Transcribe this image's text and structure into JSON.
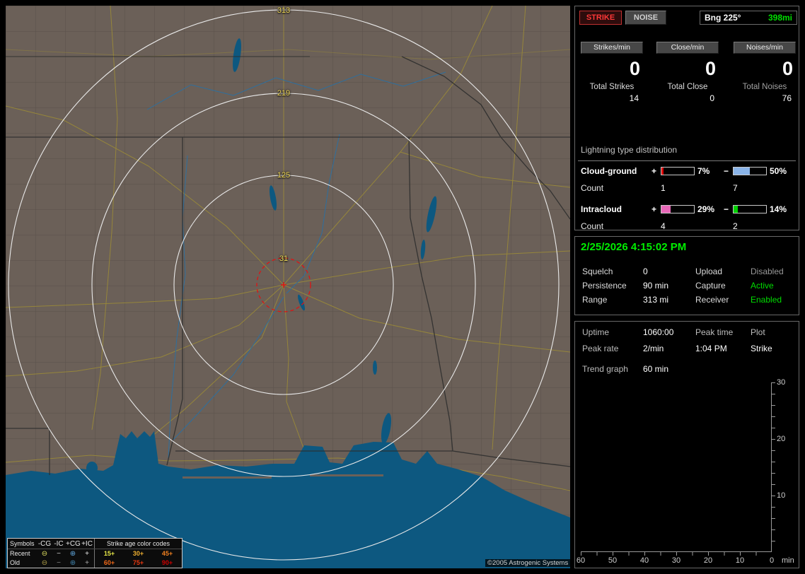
{
  "header": {
    "strike_button": "STRIKE",
    "noise_button": "NOISE",
    "bearing_label": "Bng 225°",
    "bearing_range": "398mi"
  },
  "rates": [
    {
      "label": "Strikes/min",
      "value": "0",
      "total_label": "Total Strikes",
      "total_value": "14"
    },
    {
      "label": "Close/min",
      "value": "0",
      "total_label": "Total Close",
      "total_value": "0"
    },
    {
      "label": "Noises/min",
      "value": "0",
      "total_label": "Total Noises",
      "total_value": "76"
    }
  ],
  "distribution": {
    "title": "Lightning type distribution",
    "rows": [
      {
        "label": "Cloud-ground",
        "plus_sign": "+",
        "plus_pct_num": 7,
        "plus_pct": "7%",
        "plus_color": "#e00000",
        "minus_sign": "−",
        "minus_pct_num": 50,
        "minus_pct": "50%",
        "minus_color": "#8ab4e8",
        "count_label": "Count",
        "plus_count": "1",
        "minus_count": "7"
      },
      {
        "label": "Intracloud",
        "plus_sign": "+",
        "plus_pct_num": 29,
        "plus_pct": "29%",
        "plus_color": "#e868b8",
        "minus_sign": "−",
        "minus_pct_num": 14,
        "minus_pct": "14%",
        "minus_color": "#00d000",
        "count_label": "Count",
        "plus_count": "4",
        "minus_count": "2"
      }
    ]
  },
  "status": {
    "datetime": "2/25/2026 4:15:02 PM",
    "rows": [
      {
        "label1": "Squelch",
        "value1": "0",
        "label2": "Upload",
        "value2": "Disabled",
        "value2_color": "#989898"
      },
      {
        "label1": "Persistence",
        "value1": "90 min",
        "label2": "Capture",
        "value2": "Active",
        "value2_color": "#00dd00"
      },
      {
        "label1": "Range",
        "value1": "313 mi",
        "label2": "Receiver",
        "value2": "Enabled",
        "value2_color": "#00dd00"
      }
    ]
  },
  "session": {
    "uptime_label": "Uptime",
    "uptime_value": "1060:00",
    "peak_time_label": "Peak time",
    "plot_label": "Plot",
    "peak_rate_label": "Peak rate",
    "peak_rate_value": "2/min",
    "peak_time_value": "1:04 PM",
    "plot_value": "Strike",
    "trend_label": "Trend graph",
    "trend_value": "60 min"
  },
  "trend_graph": {
    "y_labels": [
      "30",
      "20",
      "10"
    ],
    "x_labels": [
      "60",
      "50",
      "40",
      "30",
      "20",
      "10",
      "0"
    ],
    "x_unit": "min"
  },
  "map": {
    "ring_labels": [
      "313",
      "219",
      "125",
      "31"
    ],
    "copyright": "©2005 Astrogenic Systems",
    "legend": {
      "symbols_header": "Symbols",
      "type_headers": [
        "-CG",
        "-IC",
        "+CG",
        "+IC"
      ],
      "ages_header": "Strike age color codes",
      "rows": [
        {
          "label": "Recent",
          "symbols": [
            {
              "glyph": "⊖",
              "color": "#e0e060"
            },
            {
              "glyph": "−",
              "color": "#d0d0d0"
            },
            {
              "glyph": "⊕",
              "color": "#60a8e0"
            },
            {
              "glyph": "+",
              "color": "#e8e8e8"
            }
          ],
          "ages": [
            {
              "text": "15+",
              "color": "#e8e848"
            },
            {
              "text": "30+",
              "color": "#f0b030"
            },
            {
              "text": "45+",
              "color": "#f08020"
            }
          ]
        },
        {
          "label": "Old",
          "symbols": [
            {
              "glyph": "⊖",
              "color": "#b0a048"
            },
            {
              "glyph": "−",
              "color": "#8a8a8a"
            },
            {
              "glyph": "⊕",
              "color": "#4080a8"
            },
            {
              "glyph": "+",
              "color": "#a8a8a8"
            }
          ],
          "ages": [
            {
              "text": "60+",
              "color": "#f06818"
            },
            {
              "text": "75+",
              "color": "#e83810"
            },
            {
              "text": "90+",
              "color": "#c80000"
            }
          ]
        }
      ]
    }
  },
  "colors": {
    "datetime_green": "#00ee00",
    "active_green": "#00dd00",
    "disabled_gray": "#989898",
    "bearing_range_green": "#00e000",
    "strike_red": "#ff3838",
    "map_land": "#6b6058",
    "map_water": "#0d5880",
    "range_ring": "#e8e8e8",
    "ring_label_yellow": "#f0d858",
    "red_alarm_ring": "#dd1414"
  },
  "chart_data": {
    "type": "line",
    "title": "Trend graph",
    "xlabel": "min",
    "x_ticks": [
      60,
      50,
      40,
      30,
      20,
      10,
      0
    ],
    "y_ticks_labeled": [
      30,
      20,
      10
    ],
    "x_range": [
      60,
      0
    ],
    "y_range": [
      0,
      30
    ],
    "grid": false,
    "series": [
      {
        "name": "Strike",
        "values": []
      }
    ]
  }
}
